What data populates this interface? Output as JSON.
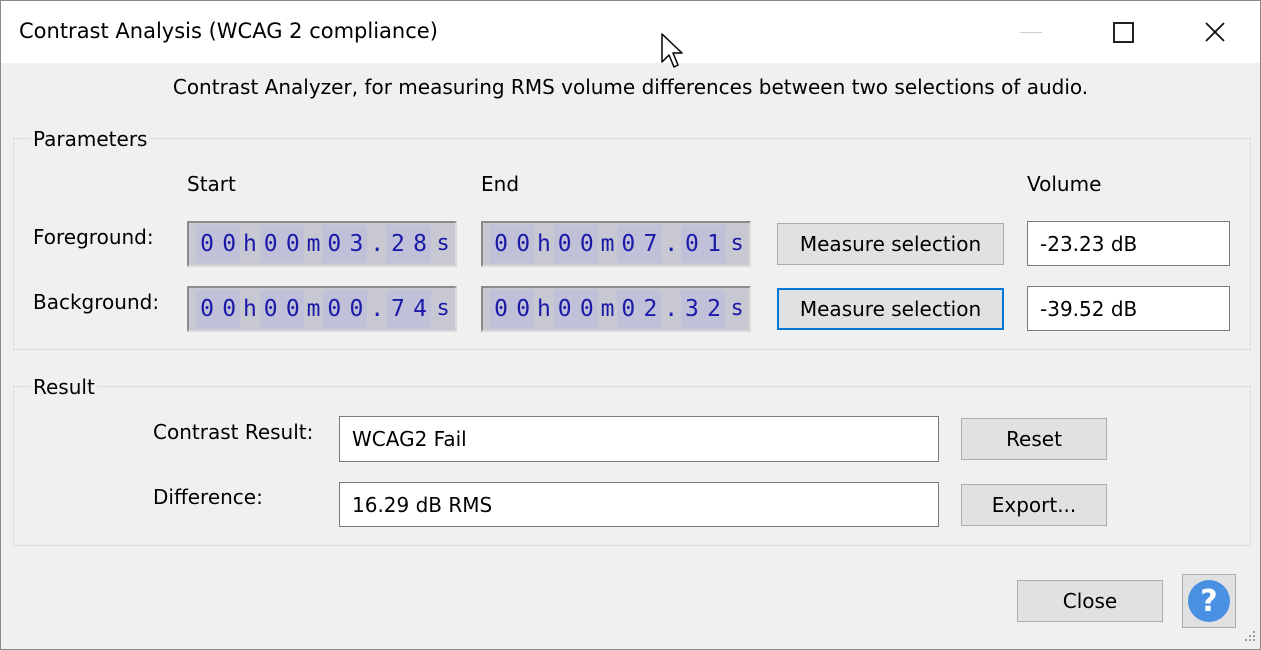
{
  "window": {
    "title": "Contrast Analysis (WCAG 2 compliance)",
    "description": "Contrast Analyzer, for measuring RMS volume differences between two selections of audio."
  },
  "parameters": {
    "label": "Parameters",
    "col_start": "Start",
    "col_end": "End",
    "col_volume": "Volume",
    "foreground": {
      "label": "Foreground:",
      "start": [
        "0",
        "0",
        "h",
        "0",
        "0",
        "m",
        "0",
        "3",
        ".",
        "2",
        "8",
        "s"
      ],
      "end": [
        "0",
        "0",
        "h",
        "0",
        "0",
        "m",
        "0",
        "7",
        ".",
        "0",
        "1",
        "s"
      ],
      "measure_label": "Measure selection",
      "volume": "-23.23 dB"
    },
    "background": {
      "label": "Background:",
      "start": [
        "0",
        "0",
        "h",
        "0",
        "0",
        "m",
        "0",
        "0",
        ".",
        "7",
        "4",
        "s"
      ],
      "end": [
        "0",
        "0",
        "h",
        "0",
        "0",
        "m",
        "0",
        "2",
        ".",
        "3",
        "2",
        "s"
      ],
      "measure_label": "Measure selection",
      "volume": "-39.52 dB"
    }
  },
  "result": {
    "label": "Result",
    "contrast_label": "Contrast Result:",
    "contrast_value": "WCAG2 Fail",
    "difference_label": "Difference:",
    "difference_value": "16.29 dB RMS",
    "reset_label": "Reset",
    "export_label": "Export..."
  },
  "footer": {
    "close_label": "Close",
    "help_glyph": "?"
  },
  "icons": {
    "minimize": "minimize-icon",
    "maximize": "maximize-icon",
    "close": "close-icon",
    "help": "help-icon",
    "cursor": "mouse-cursor-icon"
  },
  "colors": {
    "accent": "#0078d7",
    "timer_digits": "#1a1aa8",
    "help": "#4a90e2"
  }
}
